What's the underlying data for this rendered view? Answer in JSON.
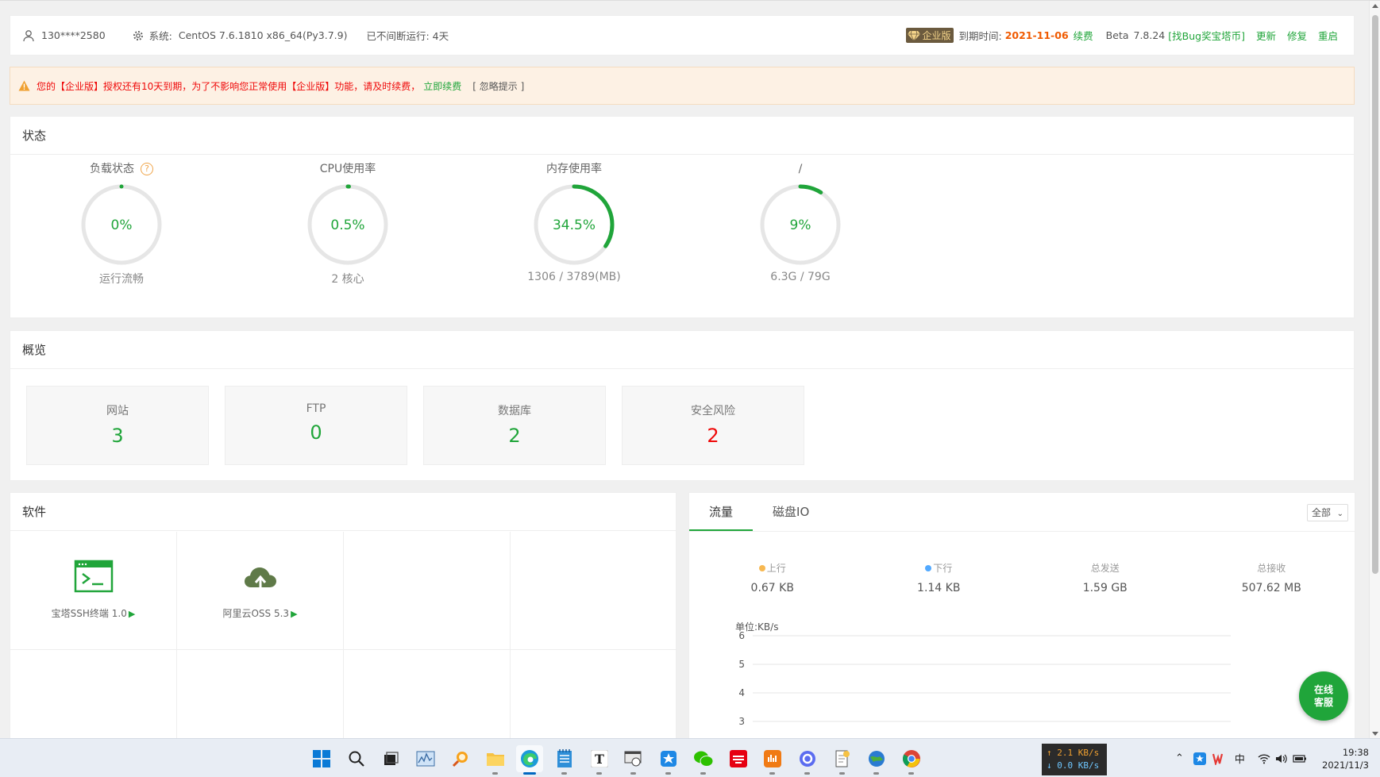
{
  "header": {
    "user": "130****2580",
    "sys_label": "系统:",
    "sys_value": "CentOS 7.6.1810 x86_64(Py3.7.9)",
    "uptime": "已不间断运行: 4天",
    "badge": "企业版",
    "expire_label": "到期时间:",
    "expire_date": "2021-11-06",
    "renew": "续费",
    "version_label": "Beta",
    "version": "7.8.24",
    "find_bug": "[找Bug奖宝塔币]",
    "update": "更新",
    "repair": "修复",
    "restart": "重启"
  },
  "notice": {
    "message": "您的【企业版】授权还有10天到期，为了不影响您正常使用【企业版】功能，请及时续费，",
    "renew_link": "立即续费",
    "ignore": "[ 忽略提示 ]"
  },
  "status": {
    "title": "状态",
    "gauges": [
      {
        "label": "负载状态",
        "value": "0%",
        "percent": 0,
        "sub": "运行流畅"
      },
      {
        "label": "CPU使用率",
        "value": "0.5%",
        "percent": 0.5,
        "sub": "2 核心"
      },
      {
        "label": "内存使用率",
        "value": "34.5%",
        "percent": 34.5,
        "sub": "1306 / 3789(MB)"
      },
      {
        "label": "/",
        "value": "9%",
        "percent": 9,
        "sub": "6.3G / 79G"
      }
    ]
  },
  "overview": {
    "title": "概览",
    "cards": [
      {
        "label": "网站",
        "value": "3"
      },
      {
        "label": "FTP",
        "value": "0"
      },
      {
        "label": "数据库",
        "value": "2"
      },
      {
        "label": "安全风险",
        "value": "2"
      }
    ]
  },
  "software": {
    "title": "软件",
    "items": [
      {
        "name": "宝塔SSH终端 1.0",
        "icon": "terminal-icon"
      },
      {
        "name": "阿里云OSS 5.3",
        "icon": "cloud-upload-icon"
      }
    ]
  },
  "traffic": {
    "tabs": [
      "流量",
      "磁盘IO"
    ],
    "select": "全部",
    "stats": [
      {
        "label": "上行",
        "value": "0.67 KB",
        "dot": "#f7b851"
      },
      {
        "label": "下行",
        "value": "1.14 KB",
        "dot": "#52a9ff"
      },
      {
        "label": "总发送",
        "value": "1.59 GB"
      },
      {
        "label": "总接收",
        "value": "507.62 MB"
      }
    ],
    "unit": "单位:KB/s",
    "chart_data": {
      "type": "line",
      "ylabel": "单位:KB/s",
      "yticks": [
        6,
        5,
        4,
        3
      ],
      "series": []
    }
  },
  "float_button": {
    "line1": "在线",
    "line2": "客服"
  },
  "taskbar": {
    "net_up": "↑ 2.1 KB/s",
    "net_down": "↓ 0.0 KB/s",
    "ime": "中",
    "time": "19:38",
    "date": "2021/11/3"
  },
  "colors": {
    "accent": "#20a53a",
    "danger": "#ef0808",
    "warn": "#f05a00"
  }
}
